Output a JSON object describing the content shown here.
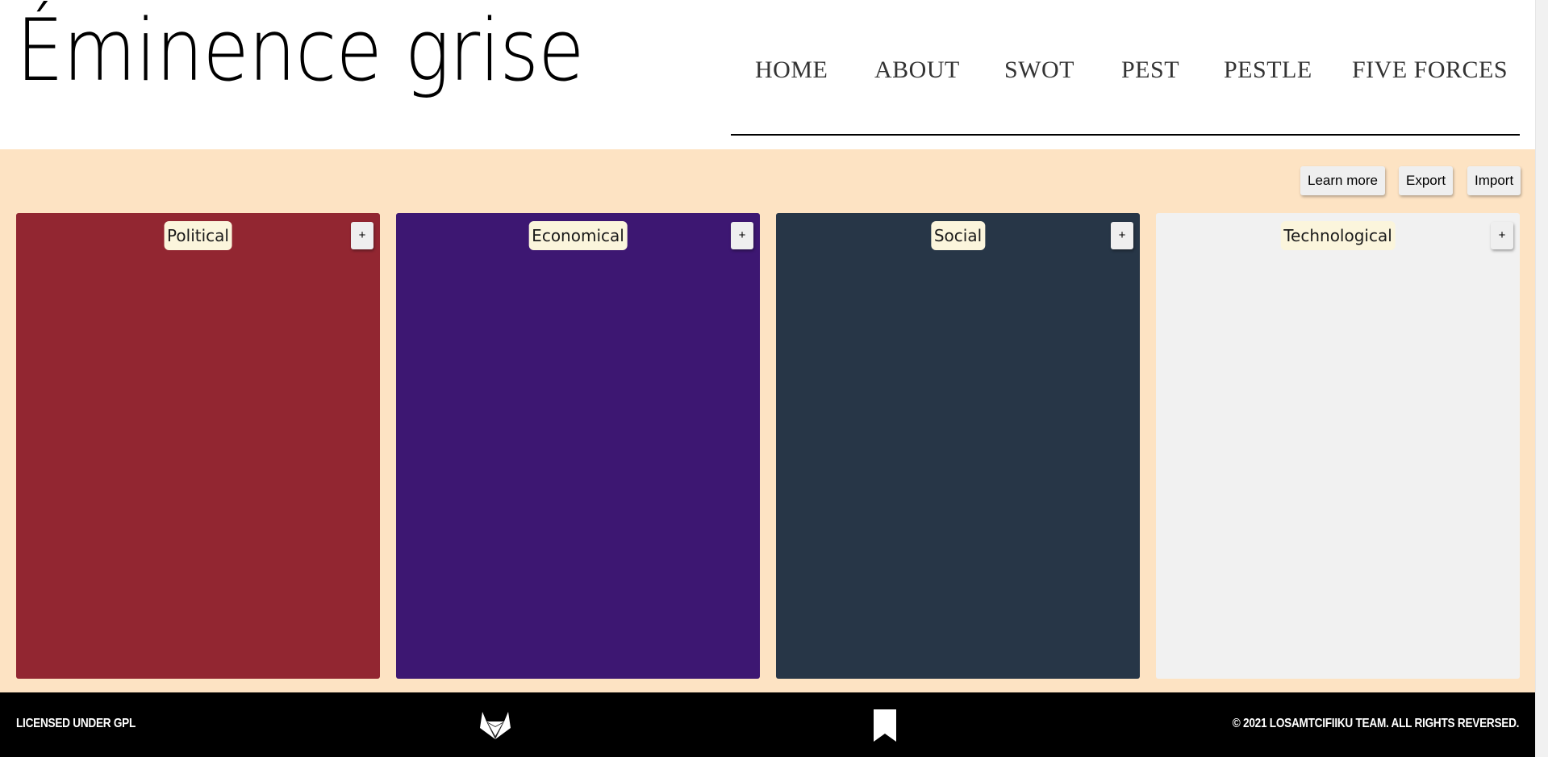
{
  "site": {
    "title": "Éminence grise"
  },
  "nav": {
    "items": [
      "HOME",
      "ABOUT",
      "SWOT",
      "PEST",
      "PESTLE",
      "FIVE FORCES"
    ]
  },
  "actions": {
    "learn_more": "Learn more",
    "export": "Export",
    "import": "Import"
  },
  "panels": [
    {
      "label": "Political",
      "add_label": "+",
      "color": "#922631"
    },
    {
      "label": "Economical",
      "add_label": "+",
      "color": "#3d1772"
    },
    {
      "label": "Social",
      "add_label": "+",
      "color": "#273647"
    },
    {
      "label": "Technological",
      "add_label": "+",
      "color": "#f1f1f1"
    }
  ],
  "footer": {
    "license": "LICENSED UNDER GPL",
    "copyright": "© 2021 LOSAMTCIFIIKU TEAM. ALL RIGHTS REVERSED.",
    "icons": [
      "gitlab-icon",
      "bookmark-icon"
    ]
  },
  "colors": {
    "background": "#fde3c3",
    "footer": "#000000",
    "label_bg": "#fbf5dc"
  }
}
